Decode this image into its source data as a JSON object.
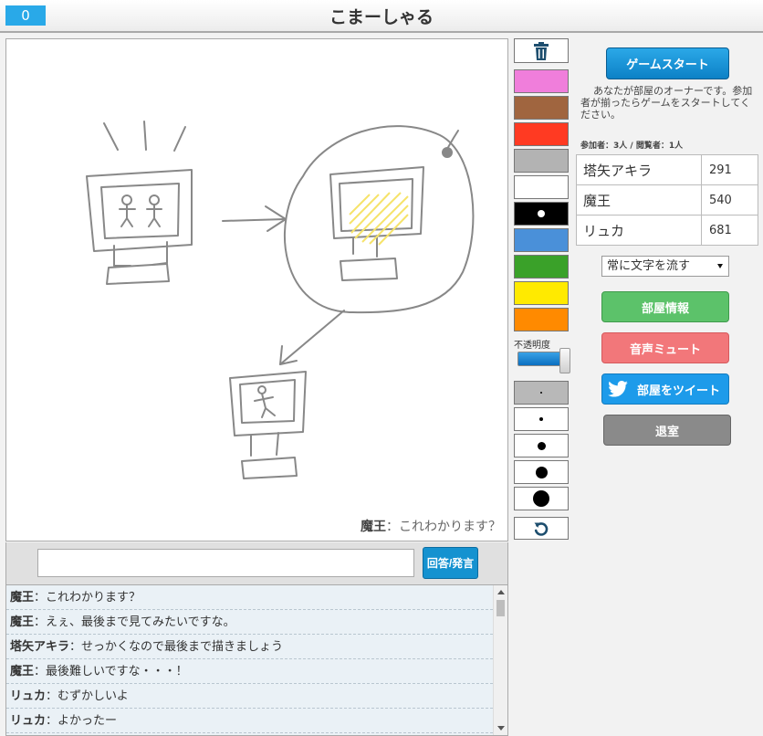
{
  "header": {
    "counter": "0",
    "title": "こまーしゃる"
  },
  "canvas": {
    "caption_name": "魔王",
    "caption_text": "これわかります？"
  },
  "answer": {
    "placeholder": "",
    "button_label": "回答/発言"
  },
  "chat": {
    "messages": [
      {
        "name": "魔王",
        "text": "これわかります？"
      },
      {
        "name": "魔王",
        "text": "えぇ、最後まで見てみたいですな。"
      },
      {
        "name": "塔矢アキラ",
        "text": "せっかくなので最後まで描きましょう"
      },
      {
        "name": "魔王",
        "text": "最後難しいですな・・・！"
      },
      {
        "name": "リュカ",
        "text": "むずかしいよ"
      },
      {
        "name": "リュカ",
        "text": "よかったー"
      }
    ]
  },
  "tools": {
    "colors": [
      "#f07edb",
      "#a0653f",
      "#ff3a22",
      "#b3b3b3",
      "#ffffff",
      "#000000",
      "#4a90d9",
      "#3aa129",
      "#ffea00",
      "#ff8a00"
    ],
    "selected_color": "#000000",
    "opacity_label": "不透明度",
    "opacity_value": 1.0,
    "pen_sizes": [
      "smallest",
      "small",
      "medium",
      "large",
      "largest"
    ],
    "selected_size": "smallest"
  },
  "panel": {
    "game_start_label": "ゲームスタート",
    "owner_message": "あなたが部屋のオーナーです。参加者が揃ったらゲームをスタートしてください。",
    "counts_text": "参加者：3人 / 閲覧者：1人",
    "players": [
      {
        "name": "塔矢アキラ",
        "score": "291"
      },
      {
        "name": "魔王",
        "score": "540"
      },
      {
        "name": "リュカ",
        "score": "681"
      }
    ],
    "flow_option": "常に文字を流す",
    "room_info_label": "部屋情報",
    "mute_label": "音声ミュート",
    "tweet_label": "部屋をツイート",
    "leave_label": "退室"
  }
}
